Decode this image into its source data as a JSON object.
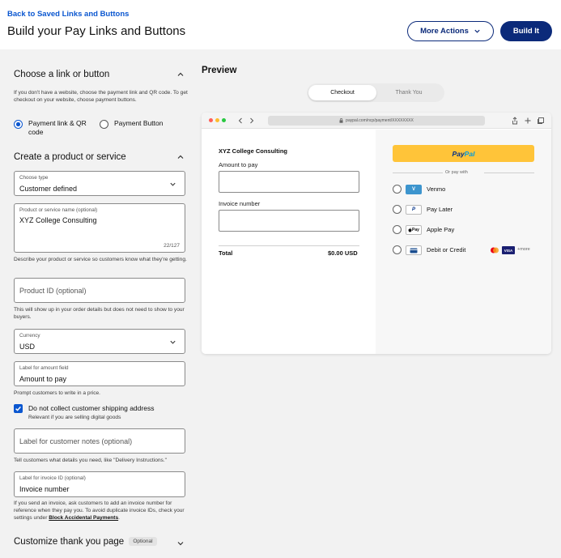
{
  "header": {
    "back_link": "Back to Saved Links and Buttons",
    "title": "Build your Pay Links and Buttons",
    "more_actions_label": "More Actions",
    "build_label": "Build It"
  },
  "left_panel": {
    "link_section": {
      "title": "Choose a link or button",
      "help": "If you don't have a website, choose the payment link and QR code. To get checkout on your website, choose payment buttons.",
      "option_link": "Payment link & QR code",
      "option_button": "Payment Button",
      "selected": "link"
    },
    "product_section": {
      "title": "Create a product or service",
      "choose_type": {
        "label": "Choose type",
        "value": "Customer defined"
      },
      "product_name": {
        "label": "Product or service name (optional)",
        "value": "XYZ College Consulting",
        "counter": "22/127",
        "help": "Describe your product or service so customers know what they're getting."
      },
      "product_id": {
        "placeholder": "Product ID (optional)",
        "help": "This will show up in your order details but does not need to show to your buyers."
      },
      "currency": {
        "label": "Currency",
        "value": "USD"
      },
      "amount_label": {
        "label": "Label for amount field",
        "value": "Amount to pay",
        "help": "Prompt customers to write in a price."
      },
      "shipping": {
        "label": "Do not collect customer shipping address",
        "sub": "Relevant if you are selling digital goods",
        "checked": true
      },
      "customer_notes": {
        "placeholder": "Label for customer notes (optional)",
        "help": "Tell customers what details you need, like \"Delivery Instructions.\""
      },
      "invoice_id": {
        "label": "Label for invoice ID (optional)",
        "value": "Invoice number",
        "help_before": "If you send an invoice, ask customers to add an invoice number for reference when they pay you. To avoid duplicate invoice IDs, check your settings under",
        "help_link": "Block Accidental Payments",
        "help_after": "."
      }
    },
    "thankyou_section": {
      "title": "Customize thank you page",
      "badge": "Optional"
    }
  },
  "preview": {
    "title": "Preview",
    "tabs": [
      "Checkout",
      "Thank You"
    ],
    "active_tab": 0,
    "browser": {
      "url": "paypal.com/ncp/payment/XXXXXXXX"
    },
    "checkout": {
      "merchant": "XYZ College Consulting",
      "amount_label": "Amount to pay",
      "invoice_label": "Invoice number",
      "total_label": "Total",
      "total_value": "$0.00 USD"
    },
    "payment": {
      "paypal_pay": "Pay",
      "paypal_pal": "Pal",
      "or_text": "Or pay with",
      "methods": [
        {
          "label": "Venmo",
          "icon": "venmo-icon"
        },
        {
          "label": "Pay Later",
          "icon": "paypal-p-icon"
        },
        {
          "label": "Apple Pay",
          "icon": "apple-pay-icon",
          "icon_text": "Pay"
        },
        {
          "label": "Debit or Credit",
          "icon": "card-icon"
        }
      ],
      "visa": "VISA",
      "more": "+more"
    }
  },
  "colors": {
    "accent": "#0b57d0",
    "navy": "#0b2a7a",
    "paypal_yellow": "#ffc439",
    "background": "#f2f2f2"
  }
}
